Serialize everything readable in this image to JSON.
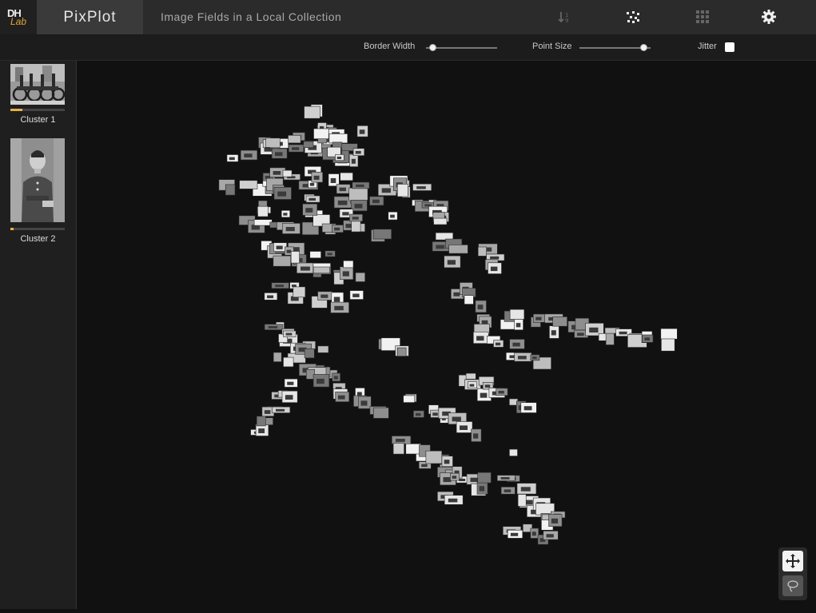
{
  "header": {
    "logo_text_top": "DH",
    "logo_text_bottom": "Lab",
    "brand": "PixPlot",
    "title": "Image Fields in a Local Collection",
    "icons": [
      "sort-icon",
      "scatter-layout-icon",
      "grid-layout-icon",
      "settings-icon"
    ]
  },
  "toolbar": {
    "border_width_label": "Border Width",
    "border_width_value": 0.05,
    "point_size_label": "Point Size",
    "point_size_value": 0.95,
    "jitter_label": "Jitter",
    "jitter_checked": false
  },
  "sidebar": {
    "clusters": [
      {
        "label": "Cluster 1",
        "progress": 0.22
      },
      {
        "label": "Cluster 2",
        "progress": 0.06
      }
    ]
  },
  "controls": [
    "pan-icon",
    "lasso-icon"
  ],
  "colors": {
    "accent": "#e8b045",
    "background": "#111111"
  }
}
